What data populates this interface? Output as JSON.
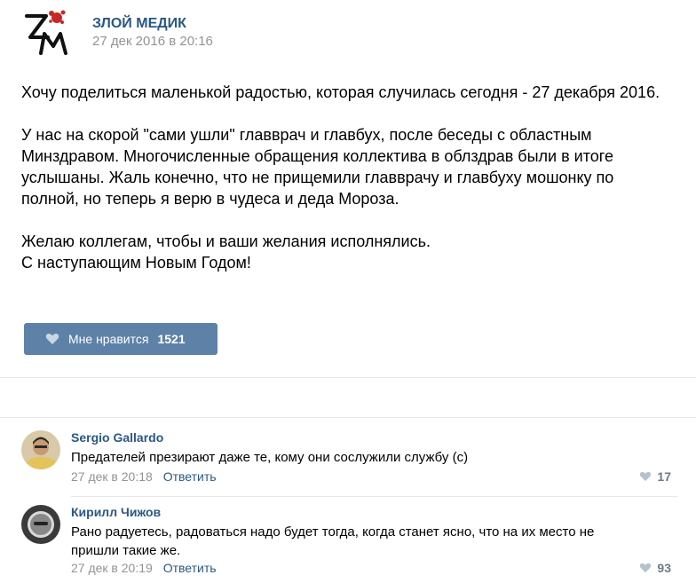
{
  "post": {
    "author": "ЗЛОЙ МЕДИК",
    "date": "27 дек 2016 в 20:16",
    "logo_text": "ЗМ",
    "paragraphs": [
      [
        "Хочу поделиться маленькой радостью, которая случилась сегодня - 27 декабря 2016."
      ],
      [
        "У нас на скорой \"сами ушли\" главврач и главбух, после беседы с областным",
        "Минздравом. Многочисленные обращения коллектива в облздрав были в итоге",
        "услышаны. Жаль конечно, что не прищемили главврачу и главбуху мошонку по",
        "полной, но теперь я верю в чудеса и деда Мороза."
      ],
      [
        "Желаю коллегам, чтобы и ваши желания исполнялись.",
        "С наступающим Новым Годом!"
      ]
    ],
    "like_label": "Мне нравится",
    "like_count": "1521"
  },
  "comments": [
    {
      "author": "Sergio Gallardo",
      "text": "Предателей презирают даже те, кому они сослужили службу (с)",
      "time": "27 дек в 20:18",
      "reply": "Ответить",
      "likes": "17"
    },
    {
      "author": "Кирилл Чижов",
      "text": "Рано радуетесь, радоваться надо будет тогда, когда станет ясно, что на их место не пришли такие же.",
      "time": "27 дек в 20:19",
      "reply": "Ответить",
      "likes": "93"
    }
  ],
  "colors": {
    "link": "#2a5885",
    "like_button": "#5e81a8",
    "muted": "#939393",
    "divider": "#e7e8ec"
  },
  "icons": {
    "logo": "logo-zm-icon",
    "like": "heart-icon"
  }
}
